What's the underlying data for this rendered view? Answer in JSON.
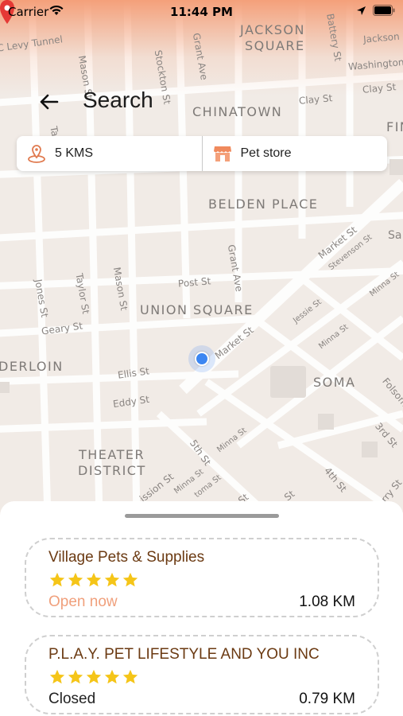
{
  "status_bar": {
    "carrier": "Carrier",
    "time": "11:44 PM"
  },
  "header": {
    "title": "Search"
  },
  "filters": {
    "distance": "5 KMS",
    "category": "Pet store"
  },
  "map": {
    "districts": [
      "JACKSON",
      "SQUARE",
      "CHINATOWN",
      "BELDEN PLACE",
      "UNION SQUARE",
      "DERLOIN",
      "SOMA",
      "THEATER",
      "DISTRICT",
      "FIN"
    ],
    "streets": [
      "C Levy Tunnel",
      "Grant Ave",
      "Battery St",
      "Jackson St",
      "Washington",
      "Mason St",
      "Stockton St",
      "Clay St",
      "Clay St",
      "Sa",
      "Market St",
      "Stevenson St",
      "Post St",
      "Grant Ave",
      "Jones St",
      "Taylor St",
      "Mason St",
      "Minna St",
      "Jessie St",
      "Geary St",
      "Market St",
      "Minna St",
      "Ellis St",
      "Eddy St",
      "Folsom",
      "5th St",
      "Minna St",
      "3rd St",
      "ission St",
      "Minna St",
      "toma St",
      "4th St",
      "rry St",
      "St",
      "St",
      "Ta"
    ]
  },
  "stores": [
    {
      "name": "Village Pets & Supplies",
      "rating": 5,
      "status": "Open now",
      "distance": "1.08 KM"
    },
    {
      "name": "P.L.A.Y. PET LIFESTYLE AND YOU INC",
      "rating": 5,
      "status": "Closed",
      "distance": "0.79 KM"
    }
  ],
  "colors": {
    "accent": "#f4a07a",
    "open": "#f0a07c",
    "closed": "#222222",
    "star": "#f5c518",
    "store_name": "#6b3a12"
  }
}
